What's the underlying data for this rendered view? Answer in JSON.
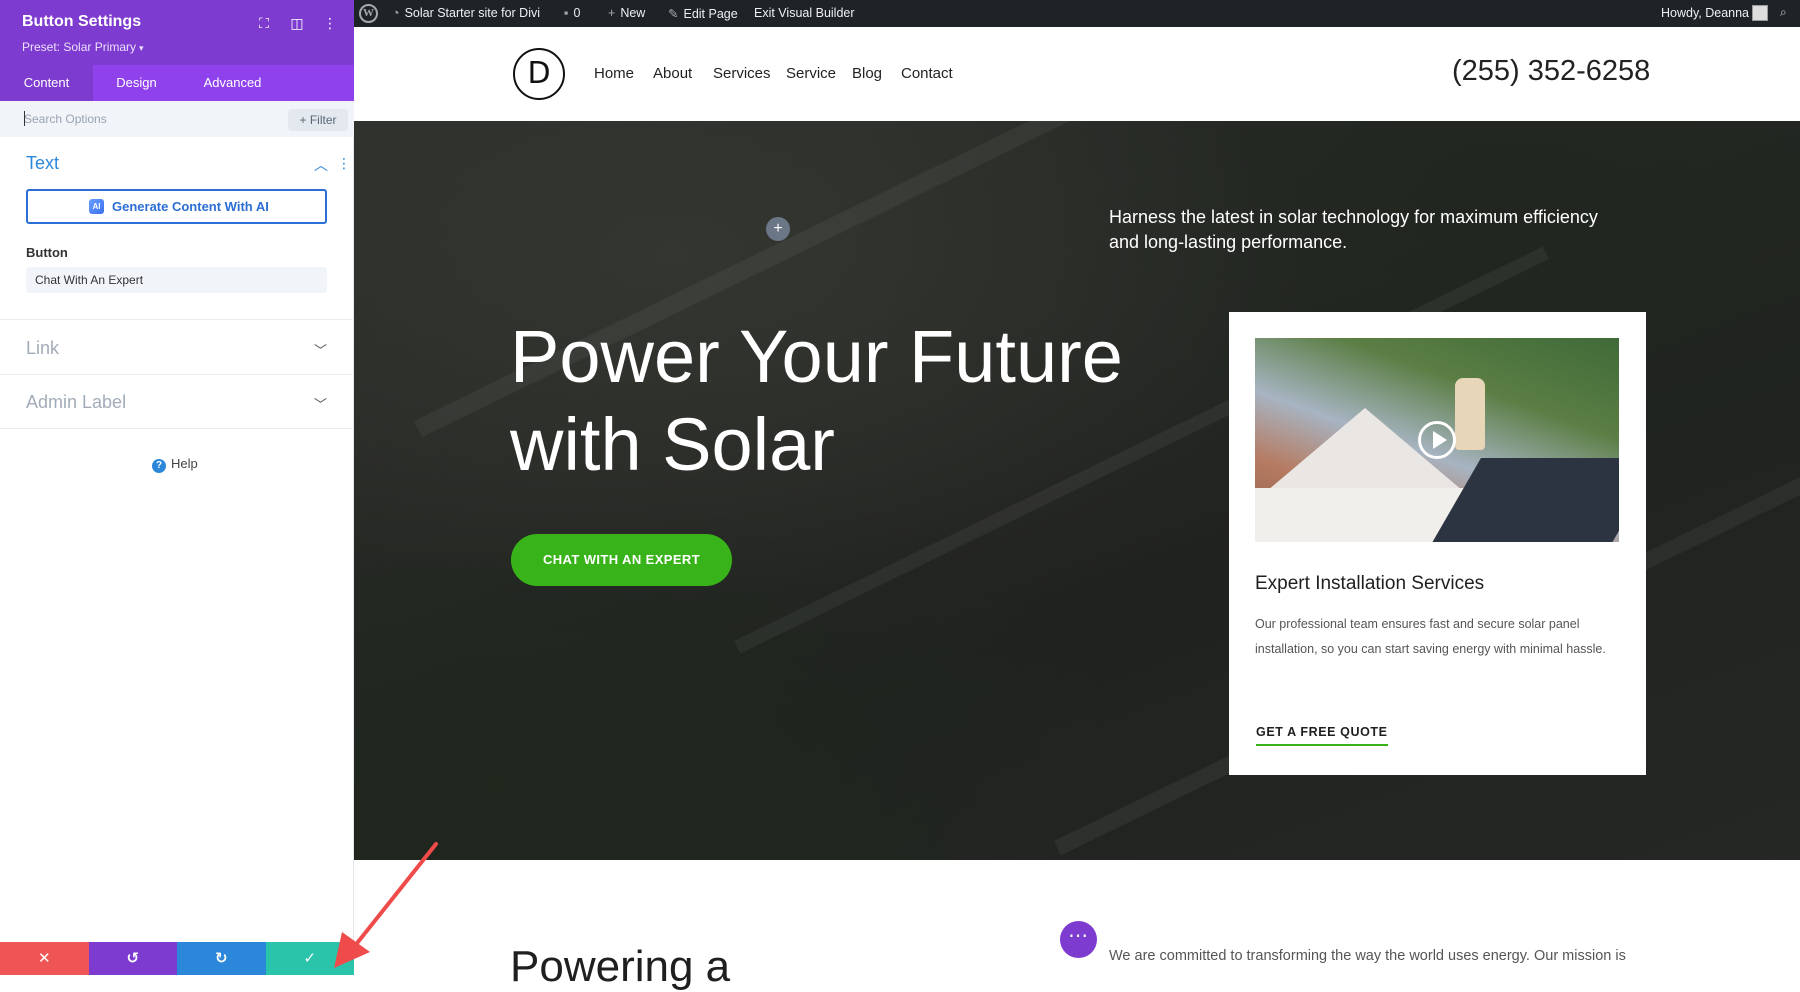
{
  "panel": {
    "title": "Button Settings",
    "preset": "Preset: Solar Primary",
    "tabs": [
      "Content",
      "Design",
      "Advanced"
    ],
    "search_placeholder": "Search Options",
    "filter_label": "Filter",
    "text_section": {
      "title": "Text",
      "ai_button": "Generate Content With AI",
      "ai_icon_text": "AI",
      "button_field_label": "Button",
      "button_field_value": "Chat With An Expert"
    },
    "link_section": "Link",
    "admin_label_section": "Admin Label",
    "help": "Help",
    "footer_colors": {
      "cancel": "#ef5555",
      "undo": "#7e3bd0",
      "redo": "#2b87da",
      "save": "#29c4a9"
    }
  },
  "adminbar": {
    "site_name": "Solar Starter site for Divi",
    "comments_count": "0",
    "new_label": "New",
    "edit_page": "Edit Page",
    "exit_builder": "Exit Visual Builder",
    "greeting": "Howdy, Deanna"
  },
  "site": {
    "logo_letter": "D",
    "nav": [
      "Home",
      "About",
      "Services",
      "Service",
      "Blog",
      "Contact"
    ],
    "phone": "(255) 352-6258"
  },
  "hero": {
    "tagline": "Harness the latest in solar technology for maximum efficiency and long-lasting performance.",
    "title": "Power Your Future with Solar",
    "cta": "CHAT WITH AN EXPERT",
    "card": {
      "title": "Expert Installation Services",
      "text": "Our professional team ensures fast and secure solar panel installation, so you can start saving energy with minimal hassle.",
      "link": "GET A FREE QUOTE"
    }
  },
  "below": {
    "title": "Powering a",
    "text": "We are committed to transforming the way the world uses energy. Our mission is"
  },
  "colors": {
    "brand_purple": "#7e3bd0",
    "accent_green": "#38b31a",
    "admin_bar": "#1d2327",
    "annotation_arrow": "#ef4b4b"
  }
}
